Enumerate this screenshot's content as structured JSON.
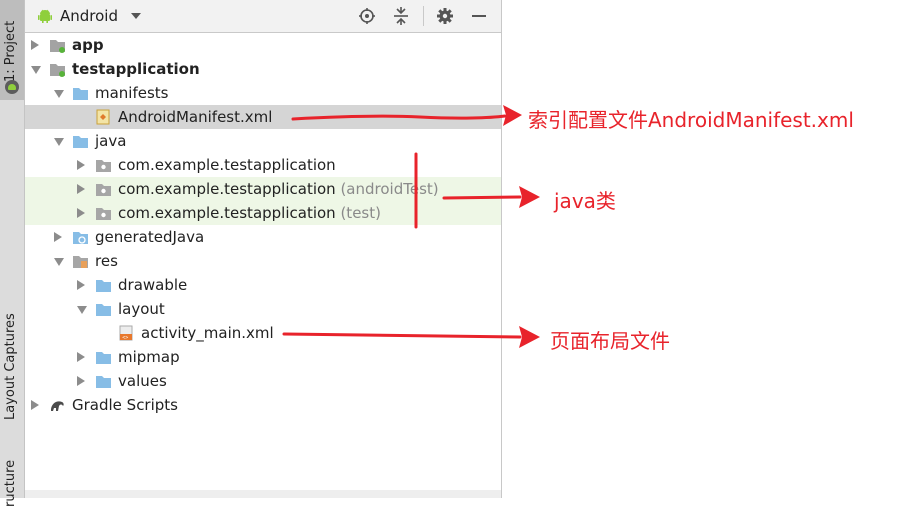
{
  "side_tabs": {
    "project": "1: Project",
    "layout_captures": "Layout Captures",
    "structure": "ructure"
  },
  "header": {
    "view_selector": "Android",
    "icons": [
      "android-icon",
      "dropdown-caret-icon",
      "locate-icon",
      "collapse-all-icon",
      "gear-icon",
      "hide-icon"
    ]
  },
  "tree": [
    {
      "label": "app",
      "bold": true,
      "arrow": "right",
      "icon": "module-folder-icon"
    },
    {
      "label": "testapplication",
      "bold": true,
      "arrow": "down",
      "icon": "module-folder-icon"
    },
    {
      "label": "manifests",
      "arrow": "down",
      "icon": "folder-icon"
    },
    {
      "label": "AndroidManifest.xml",
      "arrow": "",
      "icon": "manifest-file-icon",
      "selected": true
    },
    {
      "label": "java",
      "arrow": "down",
      "icon": "folder-icon"
    },
    {
      "label": "com.example.testapplication",
      "arrow": "right",
      "icon": "package-icon"
    },
    {
      "label": "com.example.testapplication",
      "suffix": "(androidTest)",
      "arrow": "right",
      "icon": "package-icon",
      "highlight": true
    },
    {
      "label": "com.example.testapplication",
      "suffix": "(test)",
      "arrow": "right",
      "icon": "package-icon",
      "highlight": true
    },
    {
      "label": "generatedJava",
      "arrow": "right",
      "icon": "generated-folder-icon"
    },
    {
      "label": "res",
      "arrow": "down",
      "icon": "res-folder-icon"
    },
    {
      "label": "drawable",
      "arrow": "right",
      "icon": "folder-icon"
    },
    {
      "label": "layout",
      "arrow": "down",
      "icon": "folder-icon"
    },
    {
      "label": "activity_main.xml",
      "arrow": "",
      "icon": "layout-file-icon"
    },
    {
      "label": "mipmap",
      "arrow": "right",
      "icon": "folder-icon"
    },
    {
      "label": "values",
      "arrow": "right",
      "icon": "folder-icon"
    },
    {
      "label": "Gradle Scripts",
      "arrow": "right",
      "icon": "gradle-icon"
    }
  ],
  "annotations": {
    "manifest": "索引配置文件AndroidManifest.xml",
    "java": "java类",
    "layout": "页面布局文件"
  },
  "colors": {
    "annotation": "#e8232b",
    "selection": "#d5d5d5",
    "test_highlight": "#eef7e6",
    "android_green": "#8fcf3c",
    "folder_blue": "#87bde6"
  }
}
